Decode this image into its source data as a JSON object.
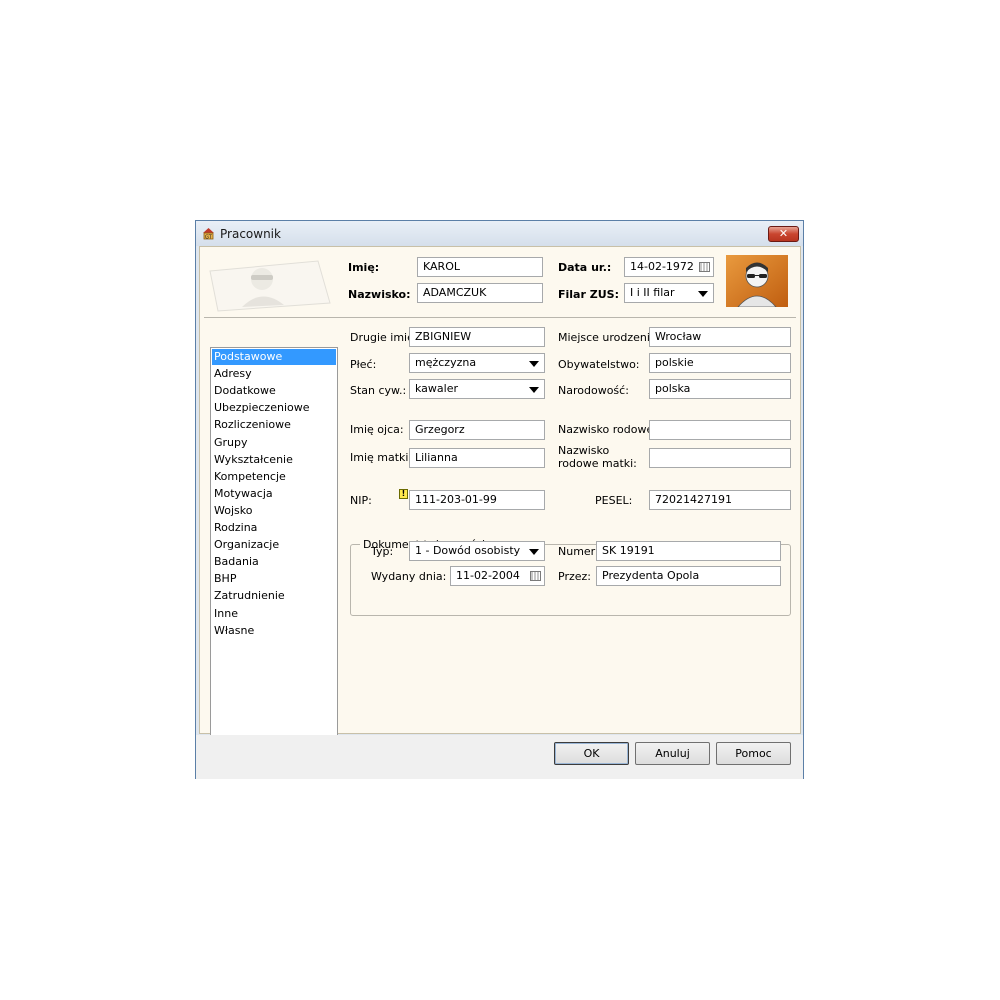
{
  "window": {
    "title": "Pracownik",
    "close_label": "✕"
  },
  "header": {
    "imie_label": "Imię:",
    "imie_value": "KAROL",
    "nazwisko_label": "Nazwisko:",
    "nazwisko_value": "ADAMCZUK",
    "data_ur_label": "Data ur.:",
    "data_ur_value": "14-02-1972",
    "filar_label": "Filar ZUS:",
    "filar_value": "I i II filar"
  },
  "sidebar": {
    "items": [
      {
        "label": "Podstawowe",
        "selected": true
      },
      {
        "label": "Adresy"
      },
      {
        "label": "Dodatkowe"
      },
      {
        "label": "Ubezpieczeniowe"
      },
      {
        "label": "Rozliczeniowe"
      },
      {
        "label": "Grupy"
      },
      {
        "label": "Wykształcenie"
      },
      {
        "label": "Kompetencje"
      },
      {
        "label": "Motywacja"
      },
      {
        "label": "Wojsko"
      },
      {
        "label": "Rodzina"
      },
      {
        "label": "Organizacje"
      },
      {
        "label": "Badania"
      },
      {
        "label": "BHP"
      },
      {
        "label": "Zatrudnienie"
      },
      {
        "label": "Inne"
      },
      {
        "label": "Własne"
      }
    ]
  },
  "form": {
    "drugie_imie_label": "Drugie imię:",
    "drugie_imie_value": "ZBIGNIEW",
    "plec_label": "Płeć:",
    "plec_value": "mężczyzna",
    "stan_label": "Stan cyw.:",
    "stan_value": "kawaler",
    "imie_ojca_label": "Imię ojca:",
    "imie_ojca_value": "Grzegorz",
    "imie_matki_label": "Imię matki:",
    "imie_matki_value": "Lilianna",
    "nip_label": "NIP:",
    "nip_value": "111-203-01-99",
    "nip_warning": "!",
    "miejsce_label": "Miejsce urodzenia:",
    "miejsce_value": "Wrocław",
    "obywatelstwo_label": "Obywatelstwo:",
    "obywatelstwo_value": "polskie",
    "narodowosc_label": "Narodowość:",
    "narodowosc_value": "polska",
    "nazwisko_rodowe_label": "Nazwisko rodowe:",
    "nazwisko_rodowe_value": "",
    "nazwisko_rodowe_matki_label1": "Nazwisko",
    "nazwisko_rodowe_matki_label2": "rodowe matki:",
    "nazwisko_rodowe_matki_value": "",
    "pesel_label": "PESEL:",
    "pesel_value": "72021427191"
  },
  "document": {
    "legend": "Dokument tożsamości",
    "typ_label": "Typ:",
    "typ_value": "1 - Dowód osobisty",
    "wydany_label": "Wydany dnia:",
    "wydany_value": "11-02-2004",
    "numer_label": "Numer:",
    "numer_value": "SK 19191",
    "przez_label": "Przez:",
    "przez_value": "Prezydenta Opola"
  },
  "buttons": {
    "ok": "OK",
    "cancel": "Anuluj",
    "help": "Pomoc"
  },
  "icons": {
    "app": "app-logo-icon",
    "close": "close-icon",
    "calendar": "calendar-icon",
    "dropdown": "chevron-down-icon",
    "photo": "person-photo-icon",
    "warning": "warning-icon"
  },
  "colors": {
    "selection": "#3399ff",
    "client_bg": "#fdf9ef",
    "photo_bg": "#d9782a",
    "close": "#c9452f"
  }
}
